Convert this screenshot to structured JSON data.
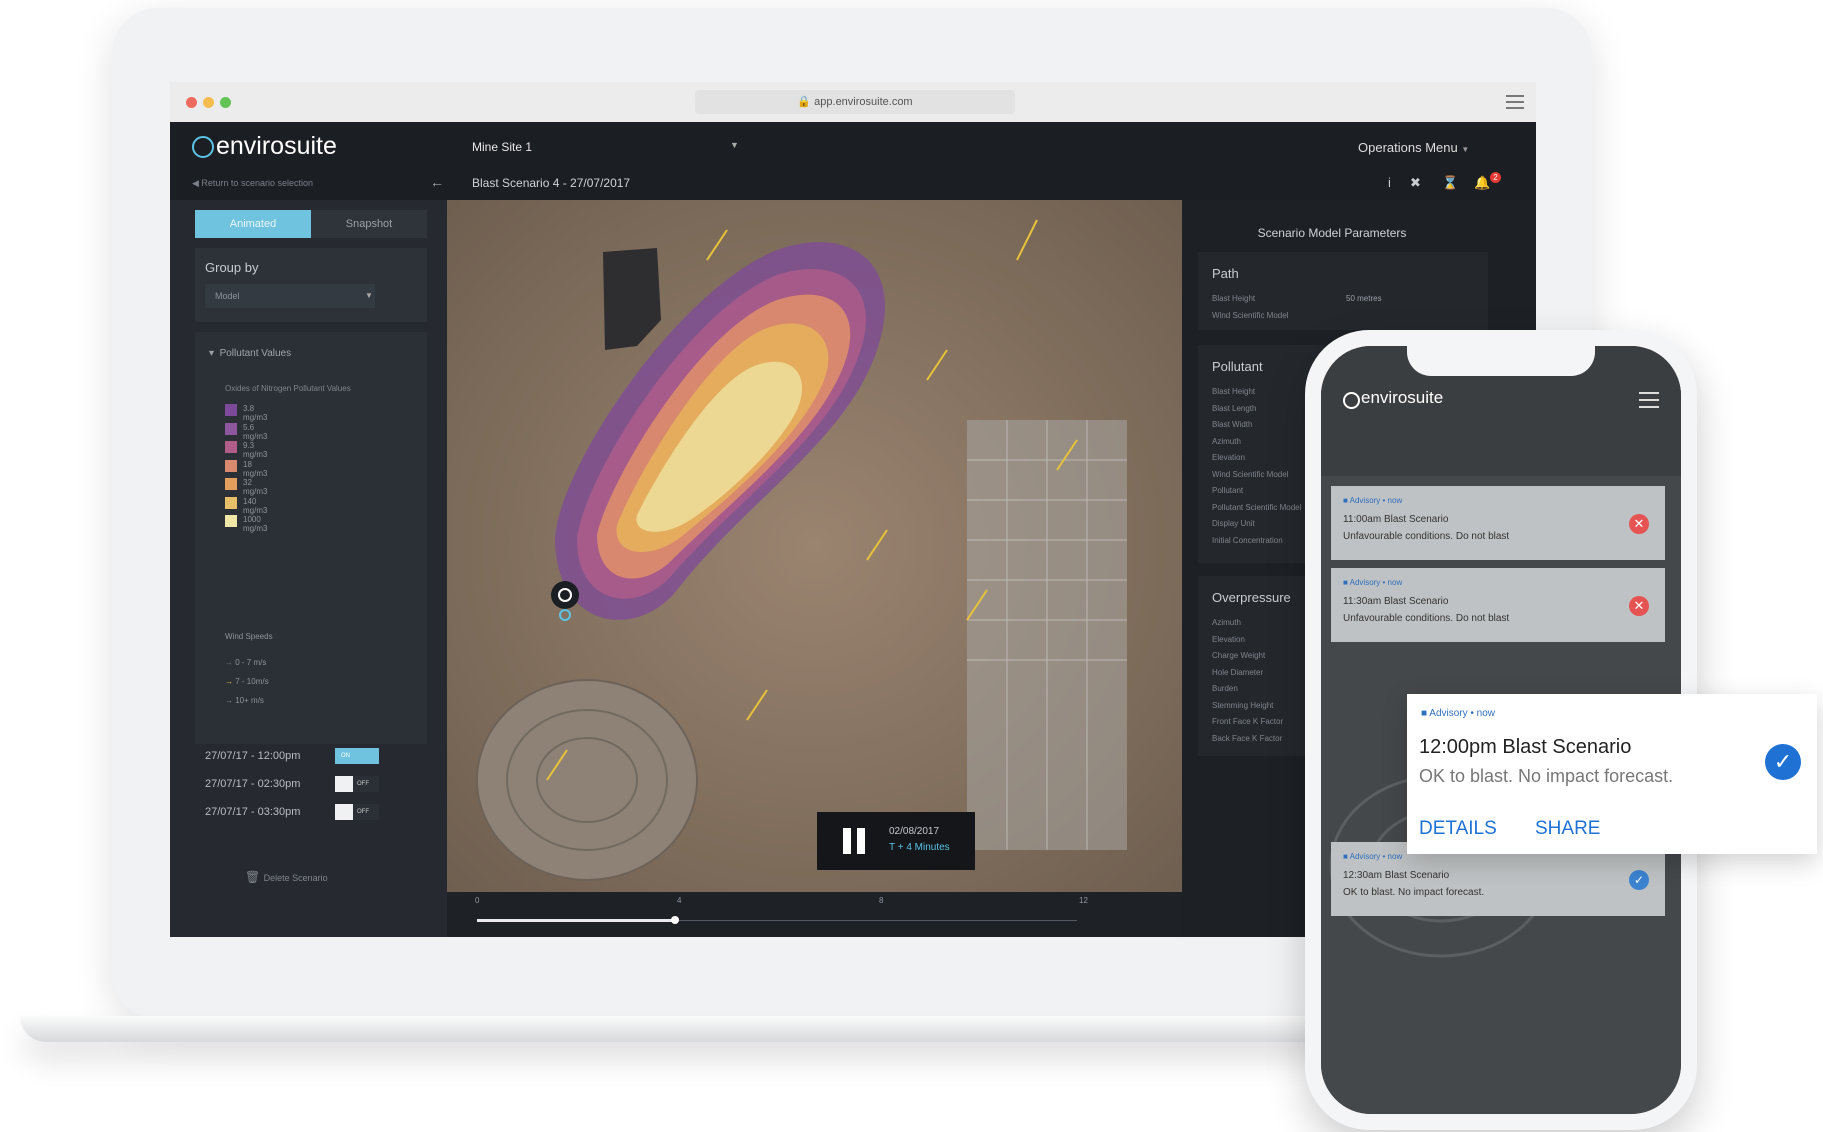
{
  "browser": {
    "url": "app.envirosuite.com"
  },
  "header": {
    "logo": "envirosuite",
    "site": "Mine Site 1",
    "operations_menu": "Operations Menu",
    "notifications_count": "2"
  },
  "subheader": {
    "back_link": "Return to scenario selection",
    "scenario_title": "Blast Scenario 4 - 27/07/2017"
  },
  "sidebar": {
    "modes": [
      "Animated",
      "Snapshot"
    ],
    "group_by": {
      "title": "Group by",
      "selected": "Model"
    },
    "legend": {
      "title": "Pollutant Values",
      "subtitle": "Oxides of Nitrogen Pollutant Values",
      "items": [
        {
          "label": "3.8 mg/m3",
          "color": "#7d4a9a"
        },
        {
          "label": "5.6 mg/m3",
          "color": "#8e569c"
        },
        {
          "label": "9.3 mg/m3",
          "color": "#b05d8a"
        },
        {
          "label": "18 mg/m3",
          "color": "#d9896e"
        },
        {
          "label": "32 mg/m3",
          "color": "#e39d5c"
        },
        {
          "label": "140 mg/m3",
          "color": "#e7bf69"
        },
        {
          "label": "1000 mg/m3",
          "color": "#efe6a8"
        }
      ]
    },
    "wind": {
      "title": "Wind Speeds",
      "items": [
        "0 - 7 m/s",
        "7 - 10m/s",
        "10+ m/s"
      ]
    },
    "times": [
      {
        "label": "27/07/17 - 12:00pm",
        "state": "ON"
      },
      {
        "label": "27/07/17 - 02:30pm",
        "state": "OFF"
      },
      {
        "label": "27/07/17 - 03:30pm",
        "state": "OFF"
      }
    ],
    "delete": "Delete Scenario"
  },
  "player": {
    "date": "02/08/2017",
    "offset": "T + 4 Minutes",
    "progress": 0.33
  },
  "timeline": {
    "ticks": [
      "0",
      "4",
      "8",
      "12"
    ]
  },
  "params": {
    "title": "Scenario Model Parameters",
    "sections": [
      {
        "heading": "Path",
        "rows": [
          {
            "label": "Blast Height",
            "value": "50 metres"
          },
          {
            "label": "Wind Scientific Model",
            "value": ""
          }
        ]
      },
      {
        "heading": "Pollutant",
        "rows": [
          {
            "label": "Blast Height",
            "value": ""
          },
          {
            "label": "Blast Length",
            "value": ""
          },
          {
            "label": "Blast Width",
            "value": ""
          },
          {
            "label": "Azimuth",
            "value": ""
          },
          {
            "label": "Elevation",
            "value": ""
          },
          {
            "label": "Wind Scientific Model",
            "value": ""
          },
          {
            "label": "Pollutant",
            "value": ""
          },
          {
            "label": "Pollutant Scientific Model",
            "value": ""
          },
          {
            "label": "Display Unit",
            "value": ""
          },
          {
            "label": "Initial Concentration",
            "value": ""
          }
        ]
      },
      {
        "heading": "Overpressure",
        "rows": [
          {
            "label": "Azimuth",
            "value": ""
          },
          {
            "label": "Elevation",
            "value": ""
          },
          {
            "label": "Charge Weight",
            "value": ""
          },
          {
            "label": "Hole Diameter",
            "value": ""
          },
          {
            "label": "Burden",
            "value": ""
          },
          {
            "label": "Stemming Height",
            "value": ""
          },
          {
            "label": "Front Face K Factor",
            "value": ""
          },
          {
            "label": "Back Face K Factor",
            "value": ""
          }
        ]
      }
    ]
  },
  "phone": {
    "logo": "envirosuite",
    "notifications": [
      {
        "tag": "Advisory • now",
        "title": "11:00am Blast Scenario",
        "body": "Unfavourable conditions. Do not blast",
        "status": "reject"
      },
      {
        "tag": "Advisory • now",
        "title": "11:30am Blast Scenario",
        "body": "Unfavourable conditions. Do not blast",
        "status": "reject"
      },
      {
        "tag": "Advisory • now",
        "title": "12:30am Blast Scenario",
        "body": "OK to blast. No impact forecast.",
        "status": "ok"
      }
    ]
  },
  "popup": {
    "tag": "Advisory • now",
    "title": "12:00pm Blast Scenario",
    "body": "OK to blast. No impact forecast.",
    "details": "DETAILS",
    "share": "SHARE"
  }
}
